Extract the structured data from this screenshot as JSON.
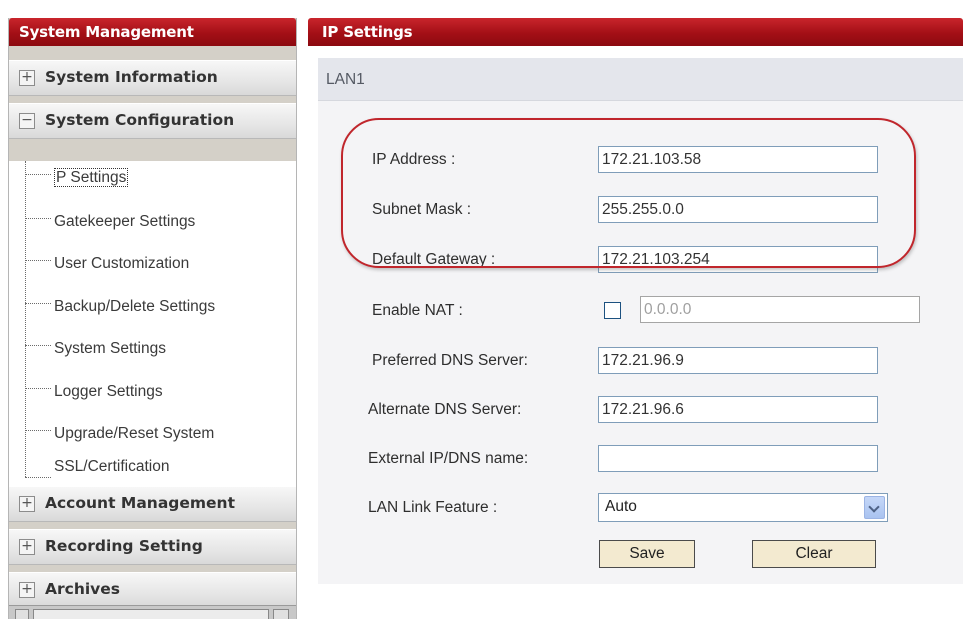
{
  "sidebar": {
    "header": "System Management",
    "sections": [
      {
        "label": "System Information",
        "icon": "plus-icon",
        "symbol": "+"
      },
      {
        "label": "System Configuration",
        "icon": "minus-icon",
        "symbol": "−"
      },
      {
        "label": "Account Management",
        "icon": "plus-icon",
        "symbol": "+"
      },
      {
        "label": "Recording Setting",
        "icon": "plus-icon",
        "symbol": "+"
      },
      {
        "label": "Archives",
        "icon": "plus-icon",
        "symbol": "+"
      }
    ],
    "sub_items": [
      {
        "label": "P Settings",
        "active": true
      },
      {
        "label": "Gatekeeper Settings"
      },
      {
        "label": "User Customization"
      },
      {
        "label": "Backup/Delete Settings"
      },
      {
        "label": "System Settings"
      },
      {
        "label": "Logger Settings"
      },
      {
        "label": "Upgrade/Reset System"
      },
      {
        "label": "SSL/Certification"
      }
    ]
  },
  "main": {
    "header": "IP Settings",
    "section_title": "LAN1",
    "fields": {
      "ip_address": {
        "label": "IP Address :",
        "value": "172.21.103.58"
      },
      "subnet_mask": {
        "label": "Subnet Mask :",
        "value": "255.255.0.0"
      },
      "default_gateway": {
        "label": "Default Gateway :",
        "value": "172.21.103.254"
      },
      "enable_nat": {
        "label": "Enable NAT :",
        "checked": false,
        "value": "0.0.0.0"
      },
      "preferred_dns": {
        "label": "Preferred DNS Server:",
        "value": "172.21.96.9"
      },
      "alternate_dns": {
        "label": "Alternate DNS Server:",
        "value": "172.21.96.6"
      },
      "external_ip": {
        "label": "External IP/DNS name:",
        "value": ""
      },
      "lan_link": {
        "label": "LAN Link Feature :",
        "value": "Auto"
      }
    },
    "buttons": {
      "save": "Save",
      "clear": "Clear"
    }
  },
  "colors": {
    "header_red": "#a30f16",
    "highlight_red": "#c0262c",
    "input_border": "#7f9db9",
    "button_bg": "#f3ead0"
  }
}
